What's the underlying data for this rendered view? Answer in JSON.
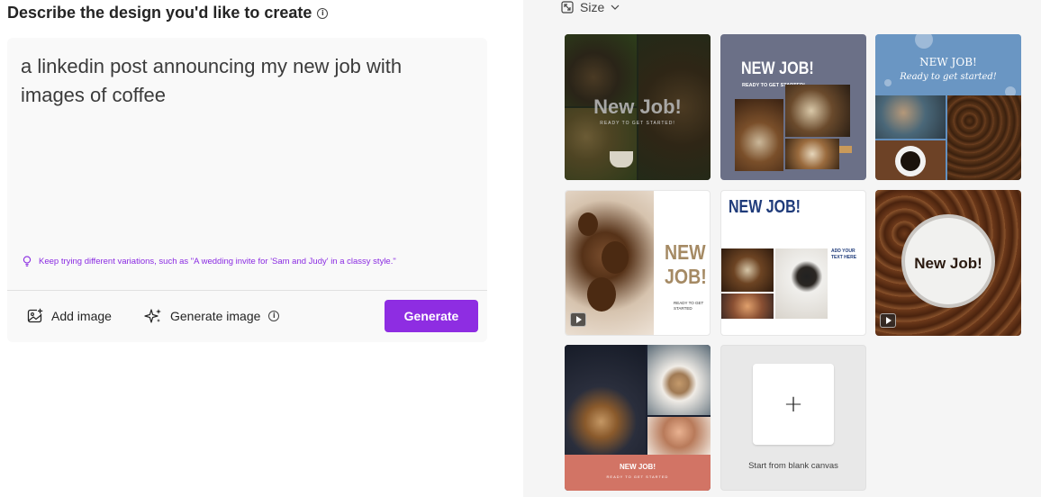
{
  "left_panel": {
    "heading": "Describe the design you'd like to create",
    "info_glyph": "i",
    "prompt_text": "a linkedin post announcing my new job with images of coffee",
    "tip": "Keep trying different variations, such as \"A wedding invite for 'Sam and Judy' in a classy style.\"",
    "add_image_label": "Add image",
    "generate_image_label": "Generate image",
    "generate_button_label": "Generate",
    "accent_color": "#8e2de2"
  },
  "right_panel": {
    "size_label": "Size",
    "templates": [
      {
        "title": "New Job!",
        "subtitle": "READY TO GET STARTED!"
      },
      {
        "title": "NEW JOB!",
        "subtitle": "READY TO GET STARTED!"
      },
      {
        "title": "NEW JOB!",
        "subtitle": "Ready to get started!"
      },
      {
        "title": "NEW JOB!",
        "subtitle": "READY TO GET STARTED"
      },
      {
        "title": "NEW JOB!",
        "subtitle": "ADD YOUR TEXT HERE"
      },
      {
        "title": "New Job!",
        "subtitle": ""
      },
      {
        "title": "NEW JOB!",
        "subtitle": "READY TO GET STARTED"
      }
    ],
    "blank_canvas": {
      "plus_glyph": "+",
      "label": "Start from blank canvas"
    }
  }
}
